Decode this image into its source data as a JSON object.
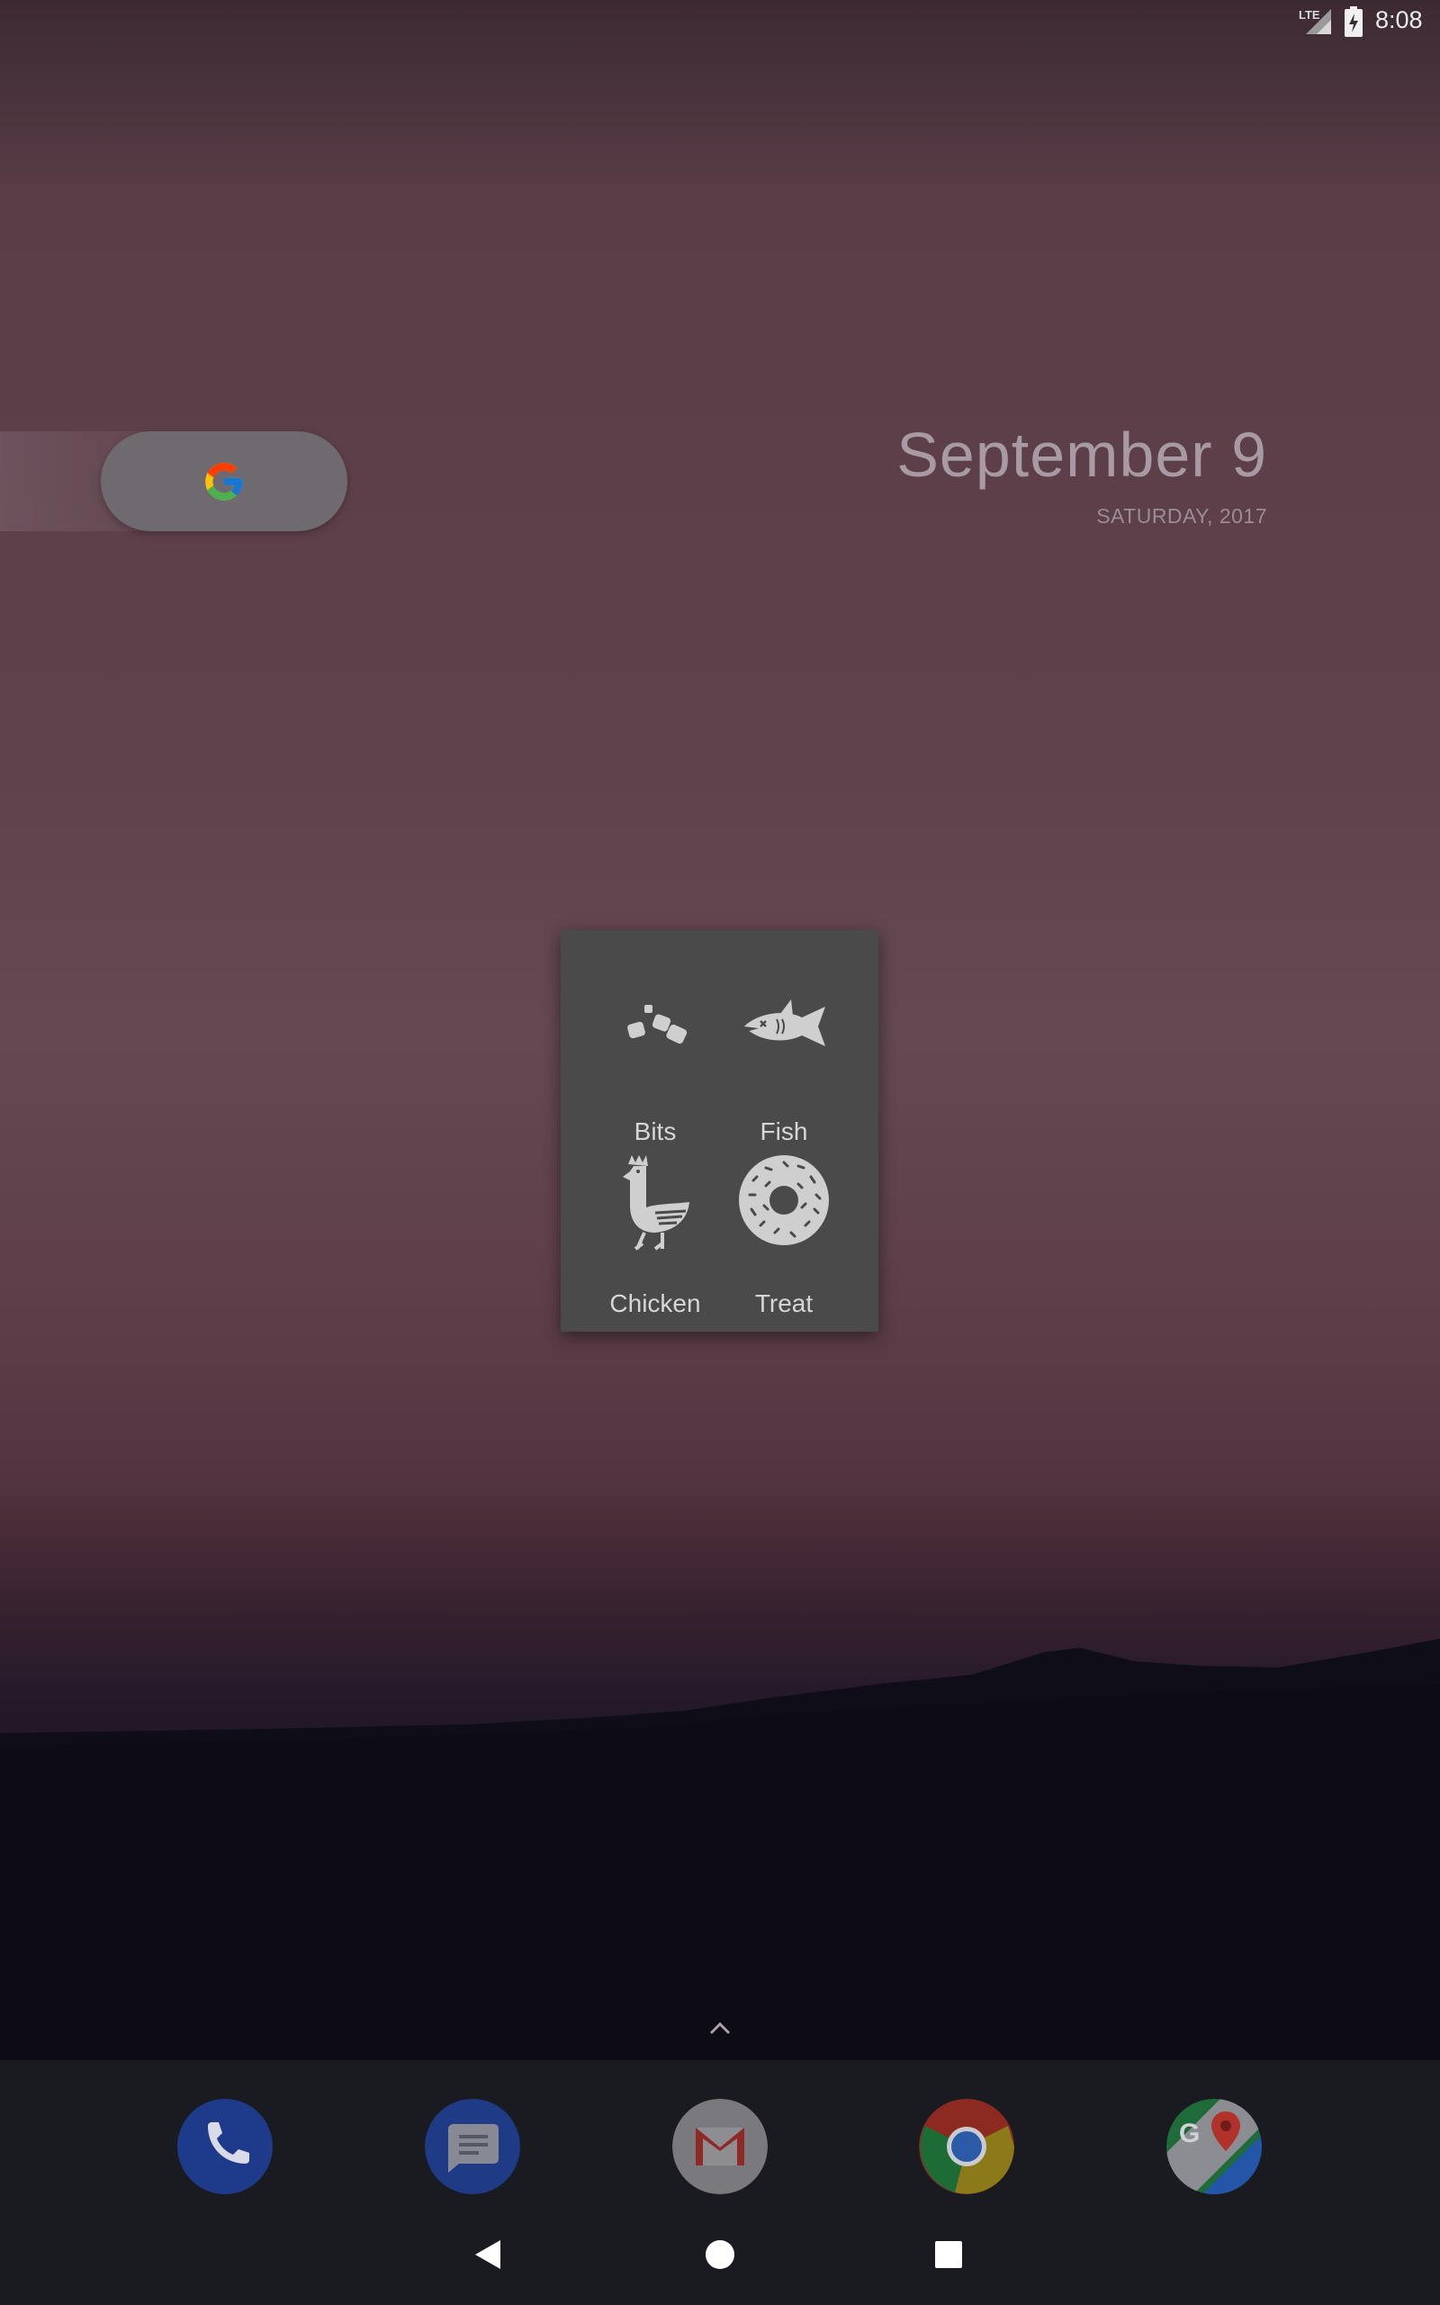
{
  "status_bar": {
    "network": "LTE",
    "time": "8:08"
  },
  "widgets": {
    "search_icon": "google-g-icon",
    "date": "September 9",
    "date_sub": "SATURDAY, 2017"
  },
  "food_menu": {
    "items": [
      {
        "label": "Bits",
        "icon": "bits-icon"
      },
      {
        "label": "Fish",
        "icon": "fish-icon"
      },
      {
        "label": "Chicken",
        "icon": "chicken-icon"
      },
      {
        "label": "Treat",
        "icon": "donut-treat-icon"
      }
    ]
  },
  "dock": {
    "apps": [
      "phone-icon",
      "messages-icon",
      "gmail-icon",
      "chrome-icon",
      "maps-icon"
    ]
  },
  "colors": {
    "menu_bg": "#4a4a4a",
    "menu_icon": "#cfcfcf",
    "dock_bg": "#1a1a21"
  }
}
